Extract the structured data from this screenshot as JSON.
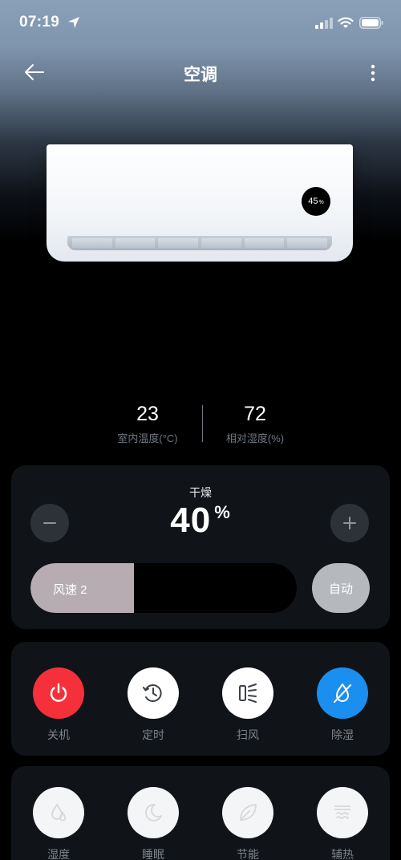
{
  "status_bar": {
    "time": "07:19"
  },
  "header": {
    "title": "空调"
  },
  "ac_unit": {
    "badge_value": "45",
    "badge_unit": "%"
  },
  "readings": {
    "temperature": {
      "value": "23",
      "label": "室内温度(°C)"
    },
    "humidity": {
      "value": "72",
      "label": "相对湿度(%)"
    }
  },
  "mode_card": {
    "label": "干燥",
    "value": "40",
    "unit": "%",
    "fan_label": "风速 2",
    "fan_level": 0.39,
    "auto_label": "自动"
  },
  "controls": [
    {
      "label": "关机",
      "icon": "power-icon",
      "color": "#f5303a"
    },
    {
      "label": "定时",
      "icon": "clock-icon",
      "color": "#ffffff"
    },
    {
      "label": "扫风",
      "icon": "swing-icon",
      "color": "#ffffff"
    },
    {
      "label": "除湿",
      "icon": "dehumidify-icon",
      "color": "#1b8ff0"
    }
  ],
  "extras": [
    {
      "label": "湿度",
      "icon": "droplet-icon"
    },
    {
      "label": "睡眠",
      "icon": "moon-icon"
    },
    {
      "label": "节能",
      "icon": "leaf-icon"
    },
    {
      "label": "辅热",
      "icon": "heat-icon"
    }
  ]
}
